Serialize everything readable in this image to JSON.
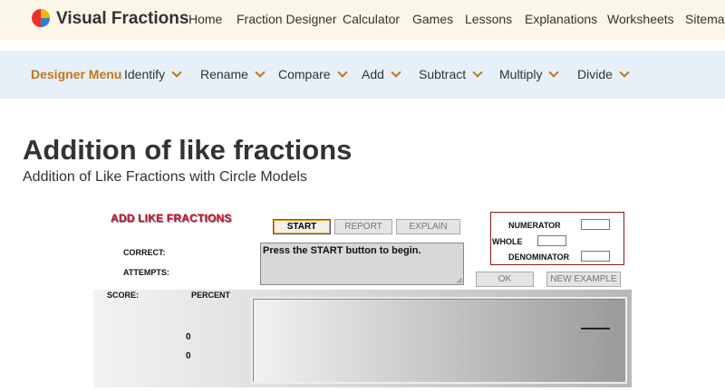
{
  "site": {
    "brand": "Visual Fractions",
    "nav": [
      "Home",
      "Fraction Designer",
      "Calculator",
      "Games",
      "Lessons",
      "Explanations",
      "Worksheets",
      "Sitemap"
    ]
  },
  "submenu": {
    "title": "Designer Menu",
    "items": [
      "Identify",
      "Rename",
      "Compare",
      "Add",
      "Subtract",
      "Multiply",
      "Divide"
    ]
  },
  "page": {
    "title": "Addition of like fractions",
    "subtitle": "Addition of Like Fractions with Circle Models"
  },
  "app": {
    "title": "ADD LIKE FRACTIONS",
    "buttons": {
      "start": "START",
      "report": "REPORT",
      "explain": "EXPLAIN",
      "ok": "OK",
      "new_example": "NEW EXAMPLE"
    },
    "labels": {
      "correct": "CORRECT:",
      "attempts": "ATTEMPTS:",
      "score": "SCORE:",
      "percent": "PERCENT"
    },
    "message": "Press the START button to begin.",
    "answer": {
      "numerator": "NUMERATOR",
      "whole": "WHOLE",
      "denominator": "DENOMINATOR"
    },
    "score_values": [
      "0",
      "0"
    ]
  },
  "colors": {
    "accent": "#c0761a",
    "app_title": "#c8102e",
    "topbar": "#fbf7e8",
    "subbar": "#e7f0f8"
  }
}
